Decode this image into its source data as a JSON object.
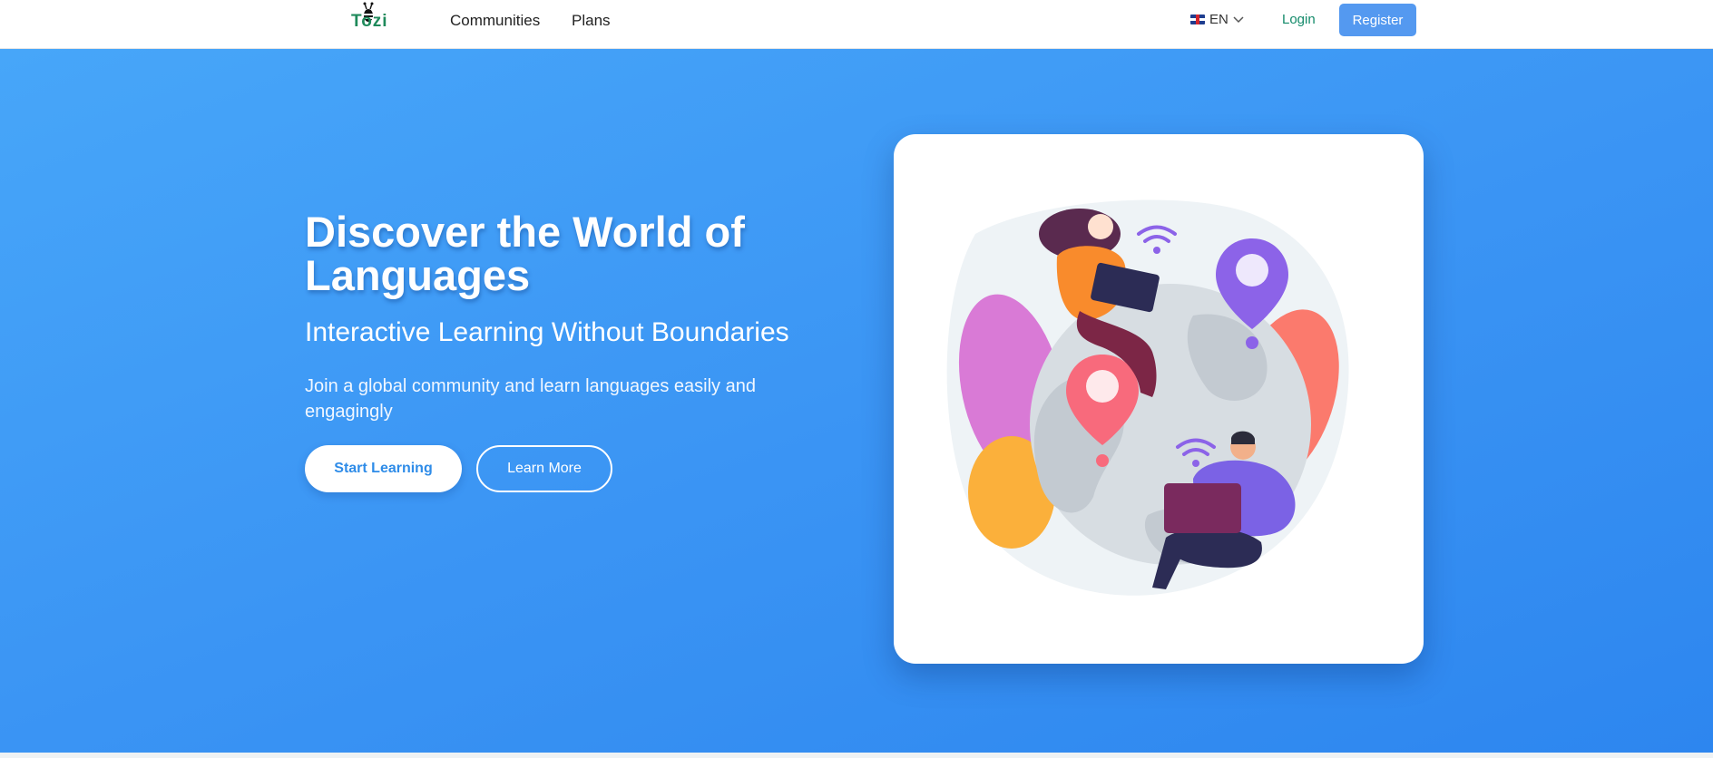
{
  "header": {
    "logo_text": "Tozi",
    "nav": [
      "Communities",
      "Plans"
    ],
    "language": {
      "flag_icon": "uk-flag-icon",
      "label": "EN"
    },
    "login_label": "Login",
    "register_label": "Register"
  },
  "hero": {
    "title": "Discover the World of Languages",
    "subtitle": "Interactive Learning Without Boundaries",
    "description": "Join a global community and learn languages easily and engagingly",
    "primary_button": "Start Learning",
    "secondary_button": "Learn More",
    "illustration": "globe-people-laptops-illustration"
  },
  "colors": {
    "accent": "#5499f0",
    "hero_gradient_start": "#47a6f9",
    "hero_gradient_end": "#2d86ef",
    "link_green": "#138a6a",
    "logo_green": "#1f8a5b"
  }
}
